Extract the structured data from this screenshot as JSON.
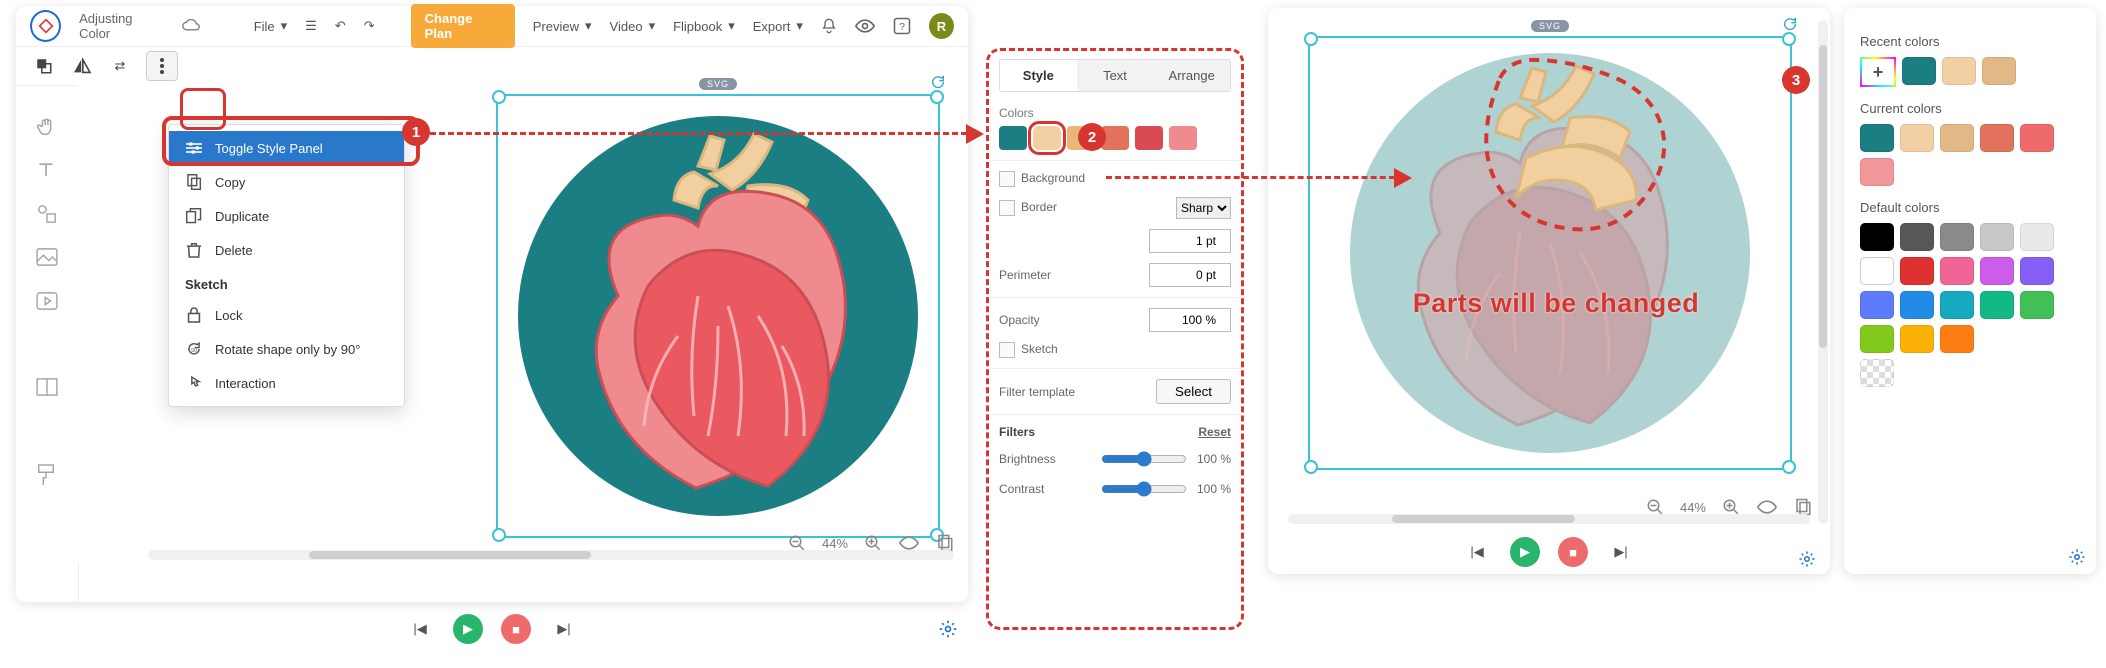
{
  "topbar": {
    "docTitle": "Adjusting Color",
    "file": "File",
    "changePlan": "Change Plan",
    "preview": "Preview",
    "video": "Video",
    "flipbook": "Flipbook",
    "export": "Export",
    "avatar": "R"
  },
  "svgBadge": "SVG",
  "ctx": {
    "toggle": "Toggle Style Panel",
    "copy": "Copy",
    "duplicate": "Duplicate",
    "delete": "Delete",
    "sketchHdr": "Sketch",
    "lock": "Lock",
    "rotate": "Rotate shape only by 90°",
    "interaction": "Interaction"
  },
  "style": {
    "tabs": {
      "style": "Style",
      "text": "Text",
      "arrange": "Arrange"
    },
    "colorsLbl": "Colors",
    "swatches": [
      "#1a7e82",
      "#f2d0a4",
      "#eab676",
      "#e2725b",
      "#d94b50",
      "#ef8a8f"
    ],
    "selectedSwatch": 1,
    "background": "Background",
    "border": "Border",
    "borderStyle": "Sharp",
    "borderPt": "1 pt",
    "perimeter": "Perimeter",
    "perimeterPt": "0 pt",
    "opacity": "Opacity",
    "opacityVal": "100 %",
    "sketch": "Sketch",
    "filterTmpl": "Filter template",
    "select": "Select",
    "filters": "Filters",
    "reset": "Reset",
    "brightness": "Brightness",
    "brightnessVal": "100 %",
    "contrast": "Contrast",
    "contrastVal": "100 %"
  },
  "zoom": "44%",
  "changed": "Parts will be changed",
  "colorsP": {
    "recent": "Recent colors",
    "recentC": [
      "#1a7e82",
      "#f2d0a4",
      "#e3b887"
    ],
    "current": "Current colors",
    "currentC": [
      "#1a7e82",
      "#f2d0a4",
      "#e3b887",
      "#e2725b",
      "#ef6a6a",
      "#f19699"
    ],
    "default": "Default colors",
    "defaultC": [
      "#000000",
      "#575757",
      "#8a8a8a",
      "#c8c8c8",
      "#e9e9e9",
      "#ffffff",
      "#e03131",
      "#f06595",
      "#cc5de8",
      "#845ef7",
      "#5c7cfa",
      "#228be6",
      "#15aabf",
      "#12b886",
      "#40c057",
      "#82c91e",
      "#fab005",
      "#fd7e14"
    ]
  },
  "badges": {
    "b1": "1",
    "b2": "2",
    "b3": "3"
  }
}
